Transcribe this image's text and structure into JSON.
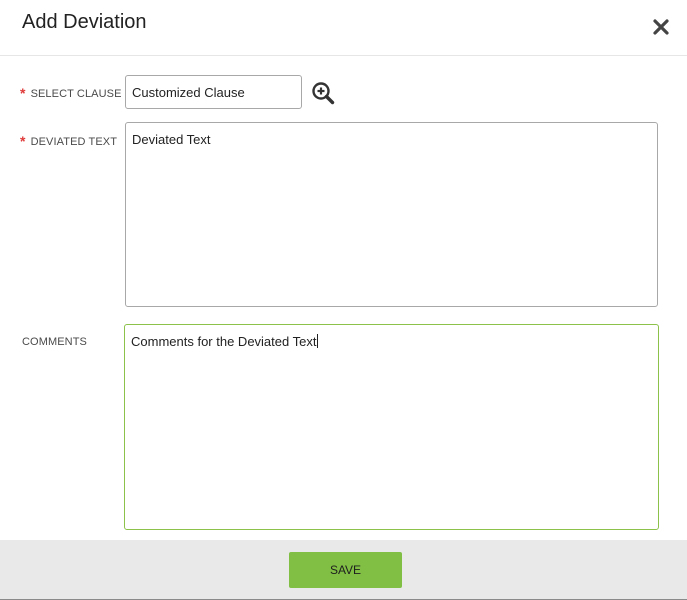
{
  "dialog": {
    "title": "Add Deviation",
    "close_icon": "close-icon"
  },
  "form": {
    "required_marker": "*",
    "select_clause": {
      "label": "SELECT CLAUSE",
      "value": "Customized Clause",
      "lookup_icon": "zoom-in-icon"
    },
    "deviated_text": {
      "label": "DEVIATED TEXT",
      "value": "Deviated Text"
    },
    "comments": {
      "label": "COMMENTS",
      "value": "Comments for the Deviated Text"
    }
  },
  "footer": {
    "save_label": "SAVE"
  },
  "colors": {
    "accent_green": "#80bf44",
    "focus_border": "#8cc14a",
    "required_red": "#e03a3a",
    "footer_bg": "#e9e9e9"
  }
}
